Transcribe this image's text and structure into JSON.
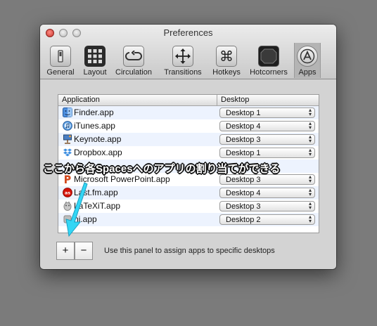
{
  "window": {
    "title": "Preferences"
  },
  "toolbar": {
    "items": [
      {
        "label": "General",
        "icon": "general-switch-icon"
      },
      {
        "label": "Layout",
        "icon": "grid-layout-icon"
      },
      {
        "label": "Circulation",
        "icon": "circulation-loop-icon"
      },
      {
        "label": "Transitions",
        "icon": "move-arrows-icon"
      },
      {
        "label": "Hotkeys",
        "icon": "command-key-icon"
      },
      {
        "label": "Hotcorners",
        "icon": "hotcorners-icon"
      },
      {
        "label": "Apps",
        "icon": "apps-store-icon"
      }
    ],
    "active": "Apps"
  },
  "table": {
    "headers": {
      "application": "Application",
      "desktop": "Desktop"
    },
    "rows": [
      {
        "app": "Finder.app",
        "icon": "finder-icon",
        "desktop": "Desktop 1"
      },
      {
        "app": "iTunes.app",
        "icon": "itunes-icon",
        "desktop": "Desktop 4"
      },
      {
        "app": "Keynote.app",
        "icon": "keynote-icon",
        "desktop": "Desktop 3"
      },
      {
        "app": "Dropbox.app",
        "icon": "dropbox-icon",
        "desktop": "Desktop 1"
      },
      {
        "app": "",
        "icon": "",
        "desktop": ""
      },
      {
        "app": "Microsoft PowerPoint.app",
        "icon": "powerpoint-icon",
        "desktop": "Desktop 3"
      },
      {
        "app": "Last.fm.app",
        "icon": "lastfm-icon",
        "desktop": "Desktop 4"
      },
      {
        "app": "LaTeXiT.app",
        "icon": "latexit-icon",
        "desktop": "Desktop 3"
      },
      {
        "app": "hi.app",
        "icon": "generic-app-icon",
        "desktop": "Desktop 2"
      }
    ]
  },
  "footer": {
    "add_label": "+",
    "remove_label": "−",
    "hint": "Use this panel to assign apps to specific desktops"
  },
  "annotation": {
    "text": "ここから各Spacesへのアプリの割り当てができる",
    "color": "#33d6f5"
  }
}
